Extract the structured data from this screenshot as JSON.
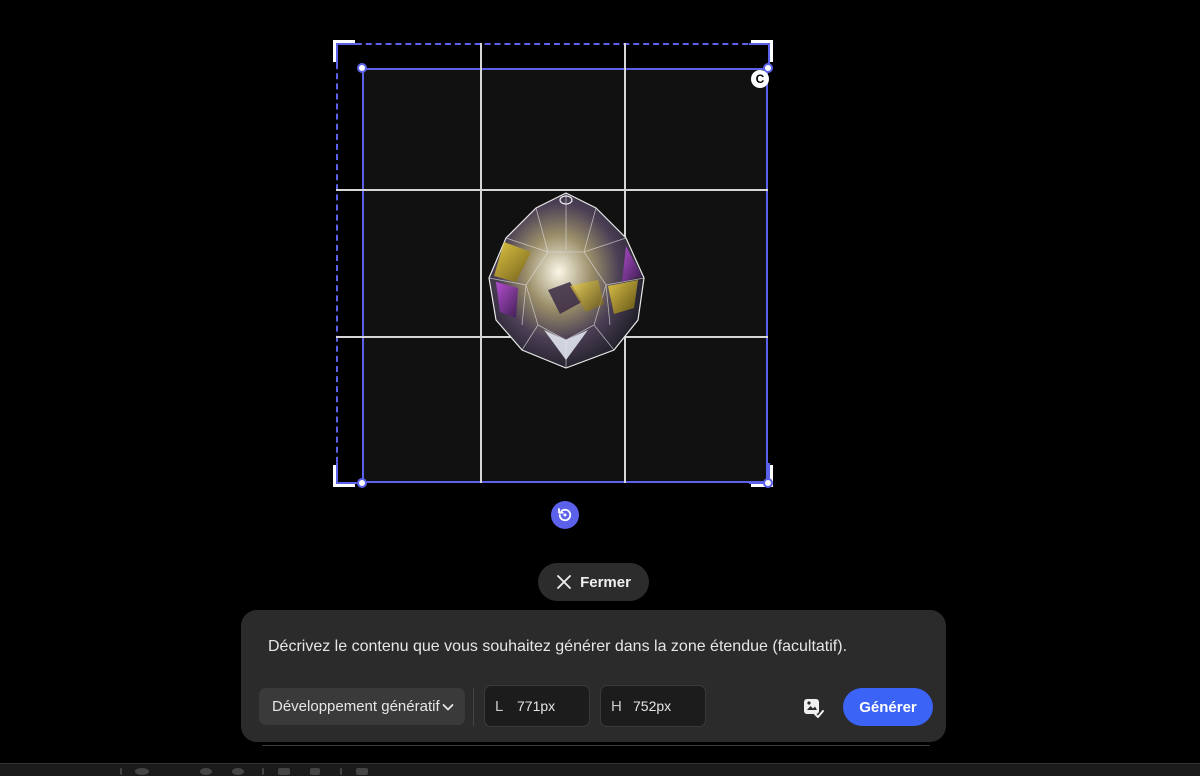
{
  "canvas": {
    "badge_label": "C"
  },
  "actions": {
    "close_label": "Fermer"
  },
  "prompt_panel": {
    "prompt_text": "Décrivez le contenu que vous souhaitez générer dans la zone étendue (facultatif).",
    "mode_value": "Développement génératif",
    "width_prefix": "L",
    "width_value": "771px",
    "height_prefix": "H",
    "height_value": "752px",
    "generate_label": "Générer"
  },
  "colors": {
    "accent": "#5b61e8",
    "generate": "#3b63f5",
    "panel": "#2b2b2b",
    "background": "#000000"
  },
  "icons": {
    "reset": "rotate-ccw-icon",
    "close": "close-icon",
    "dropdown": "chevron-down-icon",
    "variations": "generative-variations-icon"
  }
}
